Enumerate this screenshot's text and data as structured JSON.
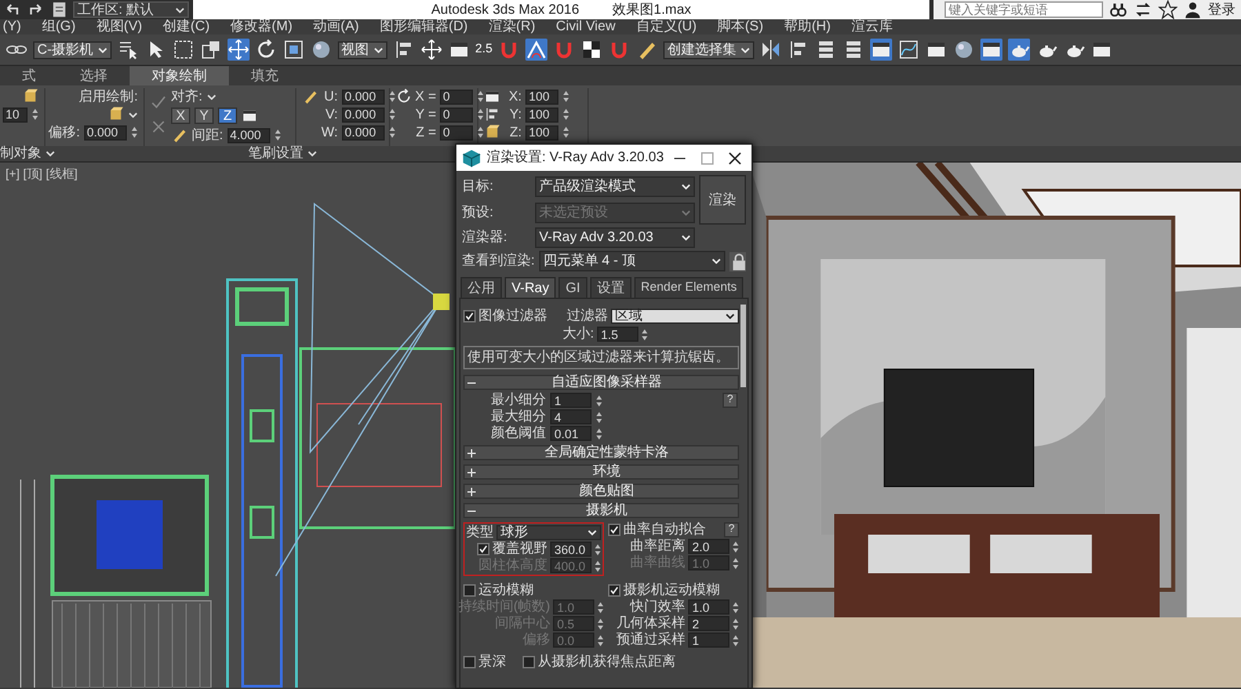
{
  "title_bar": {
    "workspace": "工作区: 默认",
    "app_title": "Autodesk 3ds Max 2016",
    "file_name": "效果图1.max",
    "search": {
      "placeholder": "键入关键字或短语"
    },
    "sign_in": "登录"
  },
  "menu_bar": [
    "(Y)",
    "组(G)",
    "视图(V)",
    "创建(C)",
    "修改器(M)",
    "动画(A)",
    "图形编辑器(D)",
    "渲染(R)",
    "Civil View",
    "自定义(U)",
    "脚本(S)",
    "帮助(H)",
    "渲云库"
  ],
  "toolbar": [
    {
      "kind": "chain-link",
      "selected": false
    },
    {
      "kind": "dropdown",
      "value": "C-摄影机"
    },
    {
      "kind": "list-cursor",
      "selected": false
    },
    {
      "kind": "cursor",
      "selected": false
    },
    {
      "kind": "dashed-square",
      "selected": false
    },
    {
      "kind": "square-pair",
      "selected": false
    },
    {
      "kind": "move",
      "selected": true
    },
    {
      "kind": "rotate",
      "selected": false
    },
    {
      "kind": "scale",
      "selected": false
    },
    {
      "kind": "sphere",
      "selected": false
    },
    {
      "kind": "dropdown",
      "value": "视图"
    },
    {
      "kind": "align",
      "selected": false
    },
    {
      "kind": "move",
      "selected": false
    },
    {
      "kind": "window",
      "selected": false
    },
    {
      "kind": "label",
      "text": "2.5"
    },
    {
      "kind": "magnet",
      "selected": false
    },
    {
      "kind": "angle",
      "selected": true
    },
    {
      "kind": "magnet",
      "selected": false
    },
    {
      "kind": "checker",
      "selected": false
    },
    {
      "kind": "magnet",
      "selected": false
    },
    {
      "kind": "pencil",
      "selected": false
    },
    {
      "kind": "dropdown",
      "value": "创建选择集"
    },
    {
      "kind": "mirror",
      "selected": false
    },
    {
      "kind": "align",
      "selected": false
    },
    {
      "kind": "layers",
      "selected": false
    },
    {
      "kind": "layers",
      "selected": false
    },
    {
      "kind": "window",
      "selected": true
    },
    {
      "kind": "graph",
      "selected": false
    },
    {
      "kind": "window",
      "selected": false
    },
    {
      "kind": "sphere",
      "selected": false
    },
    {
      "kind": "window",
      "selected": true
    },
    {
      "kind": "teapot",
      "selected": true
    },
    {
      "kind": "teapot",
      "selected": false
    },
    {
      "kind": "teapot",
      "selected": false
    },
    {
      "kind": "window",
      "selected": false
    }
  ],
  "ribbon": {
    "tabs": [
      {
        "label": "式",
        "selected": false
      },
      {
        "label": "选择",
        "selected": false
      },
      {
        "label": "对象绘制",
        "selected": true
      },
      {
        "label": "填充",
        "selected": false
      }
    ],
    "count_value": "10",
    "enable_paint": "启用绘制:",
    "offset_label": "偏移:",
    "offset_value": "0.000",
    "align_label": "对齐:",
    "axes": [
      {
        "label": "X",
        "selected": false
      },
      {
        "label": "Y",
        "selected": false
      },
      {
        "label": "Z",
        "selected": true
      }
    ],
    "spacing_label": "间距:",
    "spacing_value": "4.000",
    "uvw": [
      {
        "label": "U:",
        "value": "0.000"
      },
      {
        "label": "V:",
        "value": "0.000"
      },
      {
        "label": "W:",
        "value": "0.000"
      }
    ],
    "rotation": [
      {
        "label": "X =",
        "value": "0"
      },
      {
        "label": "Y =",
        "value": "0"
      },
      {
        "label": "Z =",
        "value": "0"
      }
    ],
    "scale": [
      {
        "label": "X:",
        "value": "100"
      },
      {
        "label": "Y:",
        "value": "100"
      },
      {
        "label": "Z:",
        "value": "100"
      }
    ],
    "footer_left": "制对象",
    "footer_center": "笔刷设置"
  },
  "viewport": {
    "label": "[+] [顶] [线框]"
  },
  "render_dialog": {
    "title": "渲染设置: V-Ray Adv 3.20.03",
    "settings": [
      {
        "label": "目标:",
        "value": "产品级渲染模式",
        "disabled": false
      },
      {
        "label": "预设:",
        "value": "未选定预设",
        "disabled": true
      },
      {
        "label": "渲染器:",
        "value": "V-Ray Adv 3.20.03",
        "disabled": false
      }
    ],
    "render_button": "渲染",
    "view_label": "查看到渲染:",
    "view_value": "四元菜单 4 - 顶",
    "tabs": [
      {
        "label": "公用",
        "selected": false
      },
      {
        "label": "V-Ray",
        "selected": true
      },
      {
        "label": "GI",
        "selected": false
      },
      {
        "label": "设置",
        "selected": false
      },
      {
        "label": "Render Elements",
        "selected": false
      }
    ],
    "image_filter": {
      "label": "图像过滤器",
      "checked": true,
      "filter_label": "过滤器",
      "filter_value": "区域",
      "size_label": "大小:",
      "size_value": "1.5",
      "description": "使用可变大小的区域过滤器来计算抗锯齿。"
    },
    "rollouts": [
      {
        "title": "自适应图像采样器",
        "expanded": true,
        "kind": "sampler"
      },
      {
        "title": "全局确定性蒙特卡洛",
        "expanded": false,
        "kind": "plain"
      },
      {
        "title": "环境",
        "expanded": false,
        "kind": "plain"
      },
      {
        "title": "颜色贴图",
        "expanded": false,
        "kind": "plain"
      },
      {
        "title": "摄影机",
        "expanded": true,
        "kind": "camera"
      }
    ],
    "sampler": {
      "fields": [
        {
          "label": "最小细分",
          "value": "1"
        },
        {
          "label": "最大细分",
          "value": "4"
        },
        {
          "label": "颜色阈值",
          "value": "0.01"
        }
      ],
      "help": "?"
    },
    "camera": {
      "type_label": "类型",
      "type_value": "球形",
      "fov": {
        "label": "覆盖视野",
        "checked": true,
        "value": "360.0"
      },
      "cylinder": {
        "label": "圆柱体高度",
        "value": "400.0",
        "disabled": true
      },
      "auto_fit": {
        "label": "曲率自动拟合",
        "checked": true
      },
      "help": "?",
      "curve_fields": [
        {
          "label": "曲率距离",
          "value": "2.0",
          "disabled": false
        },
        {
          "label": "曲率曲线",
          "value": "1.0",
          "disabled": true
        }
      ]
    },
    "motion_blur": {
      "label": "运动模糊",
      "checked": false,
      "fields": [
        {
          "label": "持续时间(帧数)",
          "value": "1.0"
        },
        {
          "label": "间隔中心",
          "value": "0.5"
        },
        {
          "label": "偏移",
          "value": "0.0"
        }
      ]
    },
    "camera_motion_blur": {
      "label": "摄影机运动模糊",
      "checked": true,
      "fields": [
        {
          "label": "快门效率",
          "value": "1.0"
        },
        {
          "label": "几何体采样",
          "value": "2"
        },
        {
          "label": "预通过采样",
          "value": "1"
        }
      ]
    },
    "depth_of_field": {
      "label": "景深",
      "checked": false
    },
    "focus_from_camera": {
      "label": "从摄影机获得焦点距离",
      "checked": false
    }
  }
}
